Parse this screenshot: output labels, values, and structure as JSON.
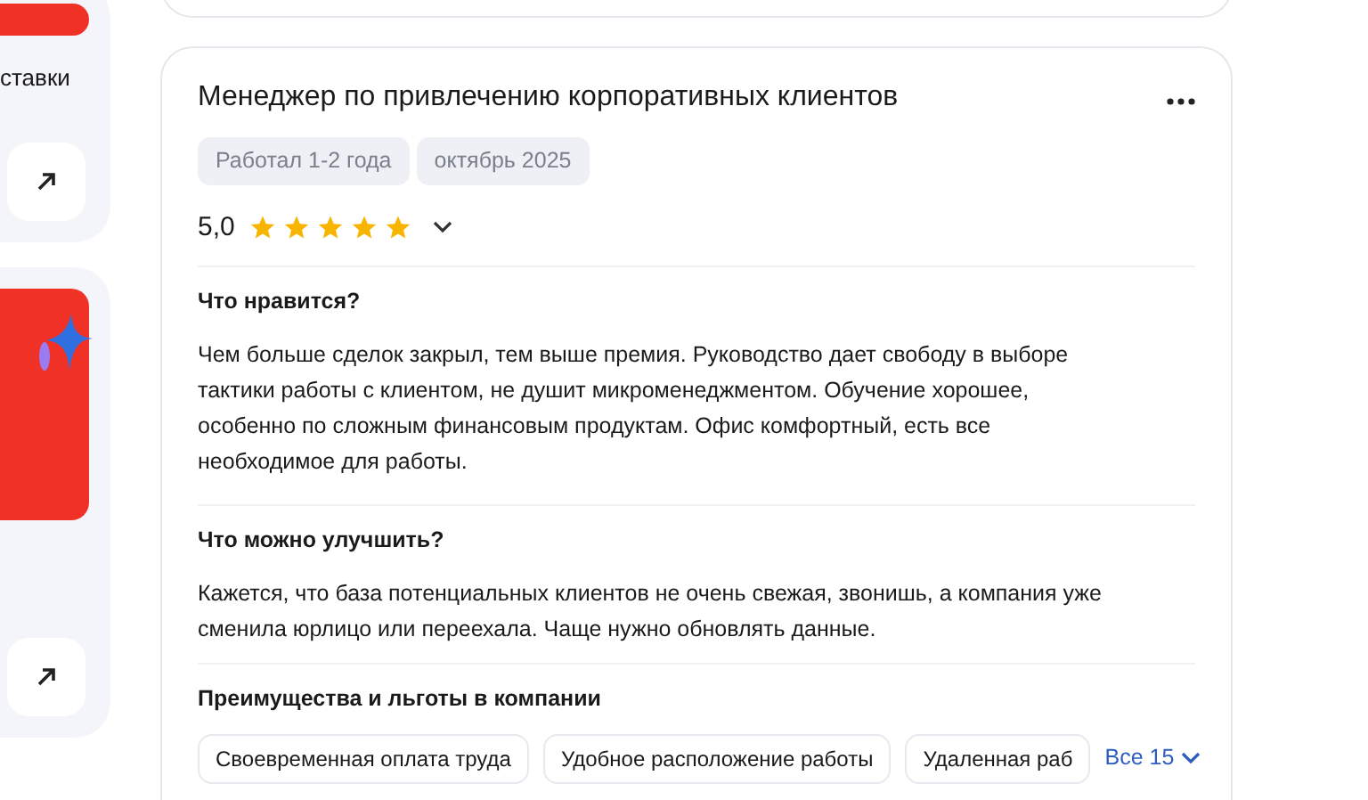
{
  "side_panels": [
    {
      "kind": "caption",
      "caption": "ставки"
    },
    {
      "kind": "banner"
    }
  ],
  "review": {
    "title": "Менеджер по привлечению корпоративных клиентов",
    "tags": [
      "Работал 1-2 года",
      "октябрь 2025"
    ],
    "rating": "5,0",
    "stars": 5,
    "expanded": false,
    "sections": [
      {
        "heading": "Что нравится?",
        "text": "Чем больше сделок закрыл, тем выше премия. Руководство дает свободу в выборе тактики работы с клиентом, не душит микроменеджментом. Обучение хорошее, особенно по сложным финансовым продуктам. Офис комфортный, есть все необходимое для работы."
      },
      {
        "heading": "Что можно улучшить?",
        "text": "Кажется, что база потенциальных клиентов не очень свежая, звонишь, а компания уже сменила юрлицо или переехала. Чаще нужно обновлять данные."
      }
    ],
    "benefits": {
      "heading": "Преимущества и льготы в компании",
      "chips": [
        "Своевременная оплата труда",
        "Удобное расположение работы",
        "Удаленная раб"
      ],
      "more": "Все 15"
    }
  }
}
